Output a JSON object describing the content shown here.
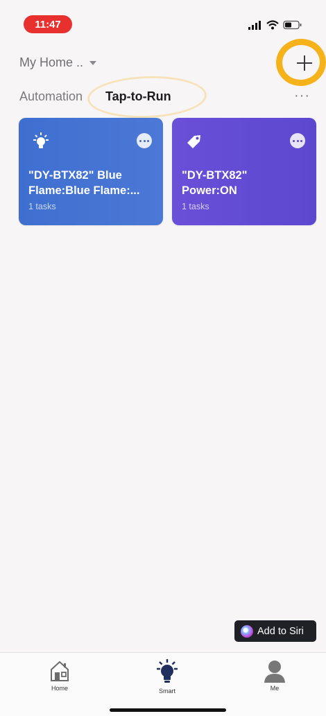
{
  "status_bar": {
    "time": "11:47"
  },
  "header": {
    "home_name": "My Home ..",
    "add_label": "+"
  },
  "tabs": [
    {
      "label": "Automation",
      "active": false
    },
    {
      "label": "Tap-to-Run",
      "active": true
    }
  ],
  "cards": [
    {
      "icon": "lightbulb-icon",
      "title": "\"DY-BTX82\" Blue\nFlame:Blue Flame:...",
      "subtitle": "1 tasks",
      "color": "#4170d1"
    },
    {
      "icon": "tag-icon",
      "title": "\"DY-BTX82\"\nPower:ON",
      "subtitle": "1 tasks",
      "color": "#6050d4"
    }
  ],
  "siri": {
    "label": "Add to Siri"
  },
  "tabbar": [
    {
      "label": "Home",
      "icon": "house-icon"
    },
    {
      "label": "Smart",
      "icon": "smart-bulb-icon",
      "active": true
    },
    {
      "label": "Me",
      "icon": "person-icon"
    }
  ]
}
